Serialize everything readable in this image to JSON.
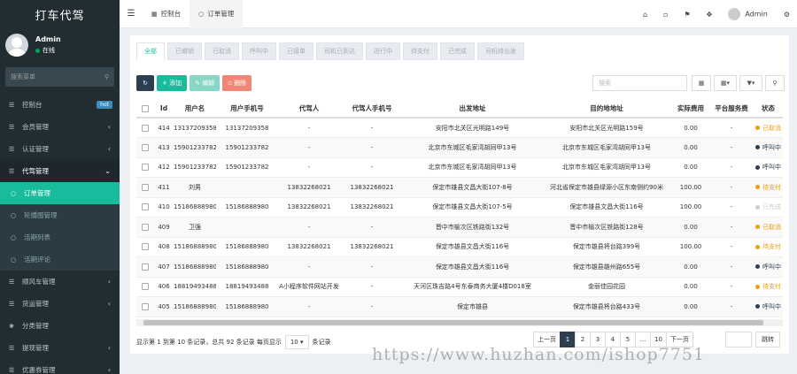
{
  "sidebar": {
    "logo": "打车代驾",
    "user_name": "Admin",
    "user_status": "在线",
    "search_placeholder": "搜索菜单",
    "items": [
      {
        "label": "控制台",
        "badge": "hot"
      },
      {
        "label": "会员管理"
      },
      {
        "label": "认证管理"
      },
      {
        "label": "代驾管理"
      },
      {
        "label": "订单管理"
      },
      {
        "label": "轮播图管理"
      },
      {
        "label": "活期列表"
      },
      {
        "label": "活期评论"
      },
      {
        "label": "顺风车管理"
      },
      {
        "label": "货运管理"
      },
      {
        "label": "分类管理"
      },
      {
        "label": "提现管理"
      },
      {
        "label": "优惠券管理"
      }
    ]
  },
  "topbar": {
    "tab_dashboard": "控制台",
    "tab_orders": "订单管理",
    "user": "Admin"
  },
  "filter_tabs": [
    "全部",
    "已撤销",
    "已取消",
    "呼叫中",
    "已接单",
    "司机已到达",
    "进行中",
    "待支付",
    "已完成",
    "司机待出发"
  ],
  "toolbar": {
    "add": "添加",
    "edit": "编辑",
    "delete": "删除",
    "search_placeholder": "搜索"
  },
  "table": {
    "headers": [
      "Id",
      "用户名",
      "用户手机号",
      "代驾人",
      "代驾人手机号",
      "出发地址",
      "目的地地址",
      "实际费用",
      "平台服务费",
      "状态"
    ],
    "rows": [
      [
        "414",
        "13137209358",
        "13137209358",
        "-",
        "-",
        "安阳市北关区光明路149号",
        "安阳市北关区光明路159号",
        "0.00",
        "-",
        "已取消"
      ],
      [
        "413",
        "15901233782",
        "15901233782",
        "-",
        "-",
        "北京市东城区毛家湾胡同甲13号",
        "北京市东城区毛家湾胡同甲13号",
        "0.00",
        "-",
        "呼叫中"
      ],
      [
        "412",
        "15901233782",
        "15901233782",
        "-",
        "-",
        "北京市东城区毛家湾胡同甲13号",
        "北京市东城区毛家湾胡同甲13号",
        "0.00",
        "-",
        "呼叫中"
      ],
      [
        "411",
        "刘男",
        "",
        "13832268021",
        "13832268021",
        "保定市雄县文昌大街107-8号",
        "河北省保定市雄县绿源小区东南侧约90米",
        "100.00",
        "-",
        "待支付"
      ],
      [
        "410",
        "15186888980",
        "15186888980",
        "13832268021",
        "13832268021",
        "保定市雄县文昌大街107-5号",
        "保定市雄县文昌大街116号",
        "100.00",
        "-",
        "已完成"
      ],
      [
        "409",
        "卫强",
        "",
        "-",
        "-",
        "晋中市榆次区铁路街132号",
        "晋中市榆次区铁路街128号",
        "0.00",
        "-",
        "已取消"
      ],
      [
        "408",
        "15186888980",
        "15186888980",
        "13832268021",
        "13832268021",
        "保定市雄县文昌大街116号",
        "保定市雄县将台路399号",
        "100.00",
        "-",
        "待支付"
      ],
      [
        "407",
        "15186888980",
        "15186888980",
        "-",
        "-",
        "保定市雄县文昌大街116号",
        "保定市雄县雄州路655号",
        "0.00",
        "-",
        "呼叫中"
      ],
      [
        "406",
        "18819493488",
        "18819493488",
        "A小程序软件网站开发",
        "-",
        "天河区珠吉路4号东泰商务大厦4楼D018室",
        "金丽佳园花园",
        "0.00",
        "-",
        "待支付"
      ],
      [
        "405",
        "15186888980",
        "15186888980",
        "-",
        "-",
        "保定市雄县",
        "保定市雄县将台路433号",
        "0.00",
        "-",
        "呼叫中"
      ]
    ],
    "status_colors": {
      "已取消": "#f39c12",
      "呼叫中": "#2c3e50",
      "待支付": "#f39c12",
      "已完成": "#cccccc"
    }
  },
  "pager": {
    "info_prefix": "显示第 1 到第 10 条记录，总共 92 条记录 每页显示",
    "page_size": "10",
    "info_suffix": "条记录",
    "prev": "上一页",
    "pages": [
      "1",
      "2",
      "3",
      "4",
      "5",
      "...",
      "10"
    ],
    "next": "下一页",
    "jump": "跳转"
  },
  "watermark": "https://www.huzhan.com/ishop7751"
}
